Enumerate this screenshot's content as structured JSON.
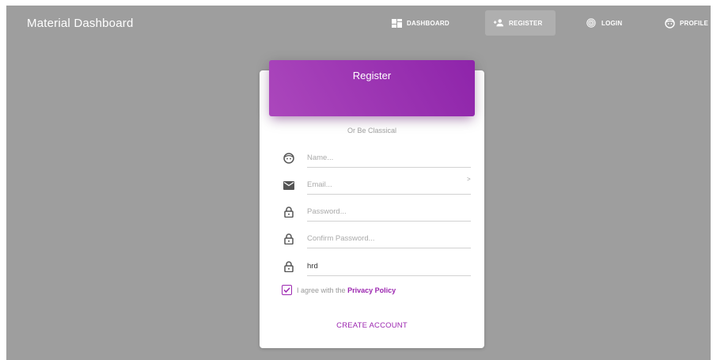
{
  "navbar": {
    "brand": "Material Dashboard",
    "items": [
      {
        "label": "DASHBOARD",
        "icon": "dashboard-icon"
      },
      {
        "label": "REGISTER",
        "icon": "person-add-icon"
      },
      {
        "label": "LOGIN",
        "icon": "fingerprint-icon"
      },
      {
        "label": "PROFILE",
        "icon": "face-icon"
      }
    ],
    "active": "REGISTER"
  },
  "card": {
    "title": "Register",
    "subtitle": "Or Be Classical",
    "fields": [
      {
        "icon": "face-icon",
        "placeholder": "Name...",
        "value": ""
      },
      {
        "icon": "mail-icon",
        "placeholder": "Email...",
        "value": ""
      },
      {
        "icon": "lock-icon",
        "placeholder": "Password...",
        "value": ""
      },
      {
        "icon": "lock-icon",
        "placeholder": "Confirm Password...",
        "value": ""
      },
      {
        "icon": "lock-icon",
        "placeholder": "",
        "value": "hrd"
      }
    ],
    "stray_mark": ">",
    "agree": {
      "checked": true,
      "text": "I agree with the",
      "link": "Privacy Policy"
    },
    "submit": "CREATE ACCOUNT"
  },
  "colors": {
    "background": "#9e9e9e",
    "accent": "#9c27b0",
    "header_gradient_start": "#ab47bc",
    "header_gradient_end": "#8e24aa"
  }
}
